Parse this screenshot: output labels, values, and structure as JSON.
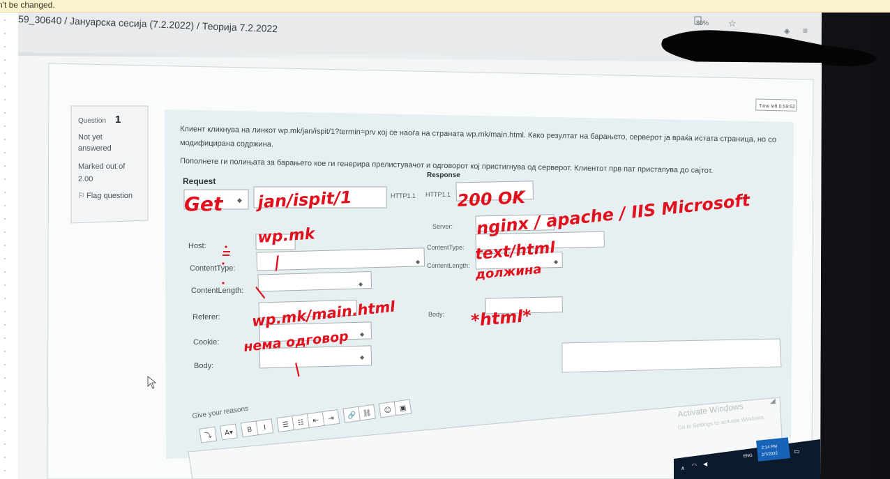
{
  "notice": {
    "text": "n't be changed."
  },
  "breadcrumb": {
    "text": "59_30640  /  Јануарска сесија (7.2.2022)  /  Теорија 7.2.2022"
  },
  "browser": {
    "zoom": "80%"
  },
  "timer": {
    "label": "Time left 0:59:52"
  },
  "question": {
    "label": "Question",
    "number": "1",
    "status_line1": "Not yet",
    "status_line2": "answered",
    "marked_line1": "Marked out of",
    "marked_line2": "2.00",
    "flag": "Flag question"
  },
  "prompt": {
    "line1": "Клиент кликнува на линкот  wp.mk/jan/ispit/1?termin=prv кој се наоѓа на страната wp.mk/main.html. Како резултат на барањето, серверот ја враќа истата страница, но со",
    "line2": "модифицирана содржина.",
    "line3": "Пополнете ги полињата за барањето кое ги генерира прелистувачот и одговорот кој пристигнува од серверот. Клиентот прв пат пристапува до сајтот."
  },
  "request": {
    "title": "Request",
    "method_value": "Get",
    "path_value": "jan/ispit/1",
    "protocol": "HTTP1.1",
    "host_label": "Host:",
    "host_value": "wp.mk",
    "ctype_label": "ContentType:",
    "ctype_value": "/",
    "clen_label": "ContentLength:",
    "clen_value": "/",
    "referer_label": "Referer:",
    "referer_value": "wp.mk/main.html",
    "cookie_label": "Cookie:",
    "cookie_value": "нема одговор",
    "body_label": "Body:",
    "body_value": "/"
  },
  "response": {
    "title": "Response",
    "protocol": "HTTP1.1",
    "status_value": "200 OK",
    "server_label": "Server:",
    "server_value": "nginx / apache / IIS Microsoft",
    "ctype_label": "ContentType:",
    "ctype_value": "text/html",
    "clen_label": "ContentLength:",
    "clen_value": "должина",
    "body_label": "Body:",
    "body_value": "*html*"
  },
  "editor": {
    "label": "Give your reasons",
    "buttons": [
      "⤵",
      "A▾",
      "B",
      "I",
      "☰",
      "☷",
      "⇤",
      "⇥",
      "🔗",
      "⛓",
      "☺",
      "▣"
    ]
  },
  "windows": {
    "activate_title": "Activate Windows",
    "activate_sub": "Go to Settings to activate Windows.",
    "clock_time": "2:14 PM",
    "clock_date": "2/7/2022",
    "lang": "ENG"
  },
  "colors": {
    "annotation": "#e0101c",
    "form_bg": "#e6f0f2",
    "photo_dark": "#17191c"
  }
}
